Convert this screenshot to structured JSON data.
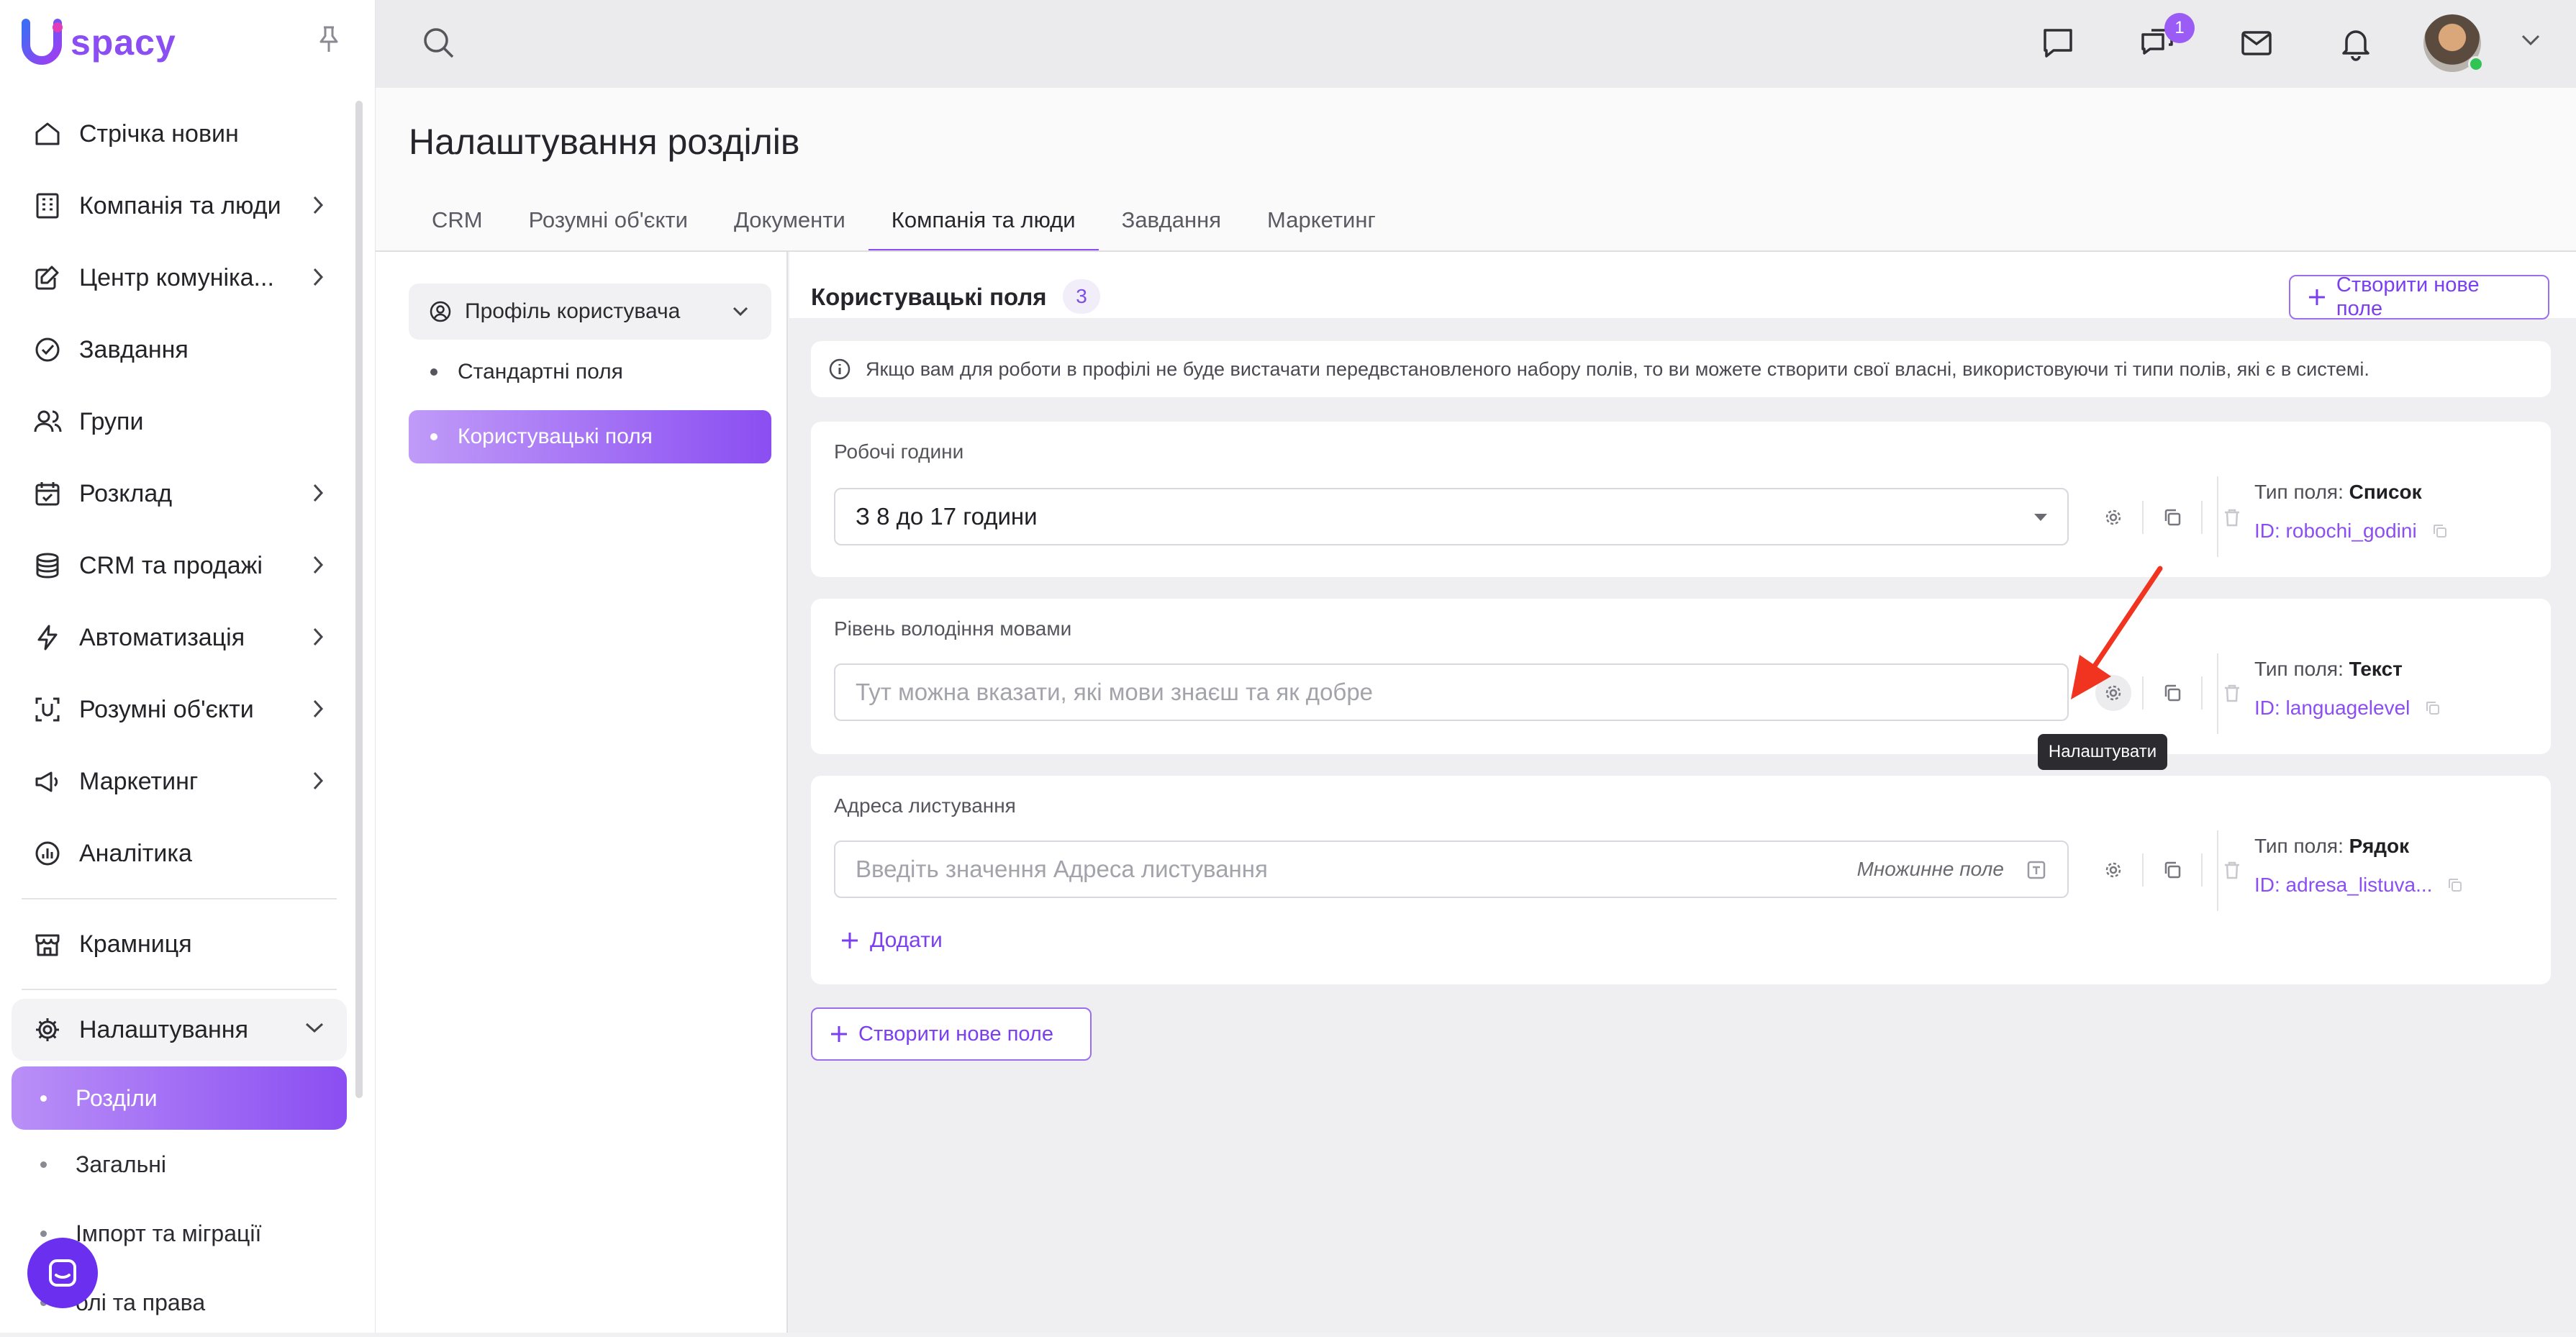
{
  "app": {
    "logo_text": "spacy",
    "logo_letter": "U"
  },
  "sidebar": {
    "items": [
      {
        "label": "Стрічка новин",
        "icon": "home-icon",
        "has_chevron": false
      },
      {
        "label": "Компанія та люди",
        "icon": "building-icon",
        "has_chevron": true
      },
      {
        "label": "Центр комуніка...",
        "icon": "edit-icon",
        "has_chevron": true
      },
      {
        "label": "Завдання",
        "icon": "check-circle-icon",
        "has_chevron": false
      },
      {
        "label": "Групи",
        "icon": "users-icon",
        "has_chevron": false
      },
      {
        "label": "Розклад",
        "icon": "calendar-icon",
        "has_chevron": true
      },
      {
        "label": "CRM та продажі",
        "icon": "coins-icon",
        "has_chevron": true
      },
      {
        "label": "Автоматизація",
        "icon": "bolt-icon",
        "has_chevron": true
      },
      {
        "label": "Розумні об'єкти",
        "icon": "scan-icon",
        "has_chevron": true
      },
      {
        "label": "Маркетинг",
        "icon": "megaphone-icon",
        "has_chevron": true
      },
      {
        "label": "Аналітика",
        "icon": "chart-icon",
        "has_chevron": false
      }
    ],
    "store": {
      "label": "Крамниця",
      "icon": "store-icon"
    },
    "settings": {
      "label": "Налаштування",
      "icon": "gear-icon"
    },
    "settings_sub": [
      {
        "label": "Розділи",
        "active": true
      },
      {
        "label": "Загальні",
        "active": false
      },
      {
        "label": "Імпорт та міграції",
        "active": false
      },
      {
        "label": "олі та права",
        "active": false
      }
    ]
  },
  "topbar": {
    "chat_badge": "1"
  },
  "header": {
    "title": "Налаштування розділів",
    "tabs": [
      "CRM",
      "Розумні об'єкти",
      "Документи",
      "Компанія та люди",
      "Завдання",
      "Маркетинг"
    ],
    "active_tab": "Компанія та люди"
  },
  "left_panel": {
    "profile_select": "Профіль користувача",
    "items": [
      {
        "label": "Стандартні поля",
        "active": false
      },
      {
        "label": "Користувацькі поля",
        "active": true
      }
    ]
  },
  "content": {
    "section_title": "Користувацькі поля",
    "count": "3",
    "create_button": "Створити нове поле",
    "info_text": "Якщо вам для роботи в профілі не буде вистачати передвстановленого набору полів, то ви можете створити свої власні, використовуючи ті типи полів, які є в системі.",
    "fields": [
      {
        "label": "Робочі години",
        "value": "З 8 до 17 години",
        "type_label": "Тип поля:",
        "type": "Список",
        "id": "ID: robochi_godini"
      },
      {
        "label": "Рівень володіння мовами",
        "placeholder": "Тут можна вказати, які мови знаєш та як добре",
        "type_label": "Тип поля:",
        "type": "Текст",
        "id": "ID: languagelevel"
      },
      {
        "label": "Адреса листування",
        "placeholder": "Введіть значення Адреса листування",
        "multi": "Множинне поле",
        "type_label": "Тип поля:",
        "type": "Рядок",
        "id": "ID: adresa_listuva...",
        "add": "Додати"
      }
    ],
    "bottom_create_button": "Створити нове поле",
    "tooltip": "Налаштувати"
  },
  "colors": {
    "accent": "#8b4ef2",
    "arrow": "#f0341f"
  }
}
